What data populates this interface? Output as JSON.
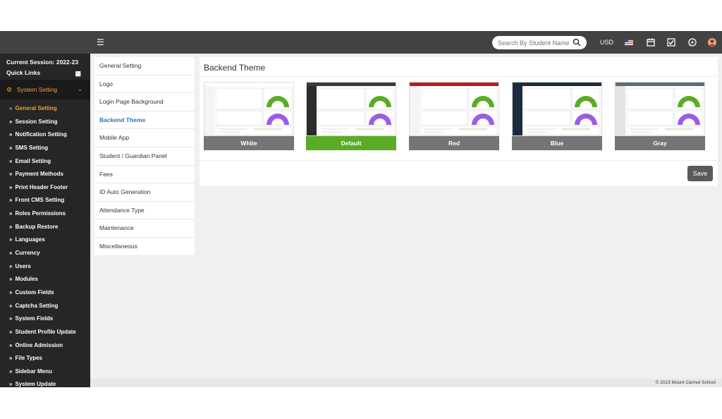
{
  "topbar": {
    "search_placeholder": "Search By Student Name",
    "currency": "USD"
  },
  "sidebar": {
    "session": "Current Session: 2022-23",
    "quick_links": "Quick Links",
    "section": "System Setting",
    "items": [
      {
        "label": "General Setting"
      },
      {
        "label": "Session Setting"
      },
      {
        "label": "Notification Setting"
      },
      {
        "label": "SMS Setting"
      },
      {
        "label": "Email Setting"
      },
      {
        "label": "Payment Methods"
      },
      {
        "label": "Print Header Footer"
      },
      {
        "label": "Front CMS Setting"
      },
      {
        "label": "Roles Permissions"
      },
      {
        "label": "Backup Restore"
      },
      {
        "label": "Languages"
      },
      {
        "label": "Currency"
      },
      {
        "label": "Users"
      },
      {
        "label": "Modules"
      },
      {
        "label": "Custom Fields"
      },
      {
        "label": "Captcha Setting"
      },
      {
        "label": "System Fields"
      },
      {
        "label": "Student Profile Update"
      },
      {
        "label": "Online Admission"
      },
      {
        "label": "File Types"
      },
      {
        "label": "Sidebar Menu"
      },
      {
        "label": "System Update"
      }
    ]
  },
  "settings_menu": [
    {
      "label": "General Setting"
    },
    {
      "label": "Logo"
    },
    {
      "label": "Login Page Background"
    },
    {
      "label": "Backend Theme"
    },
    {
      "label": "Mobile App"
    },
    {
      "label": "Student / Guardian Panel"
    },
    {
      "label": "Fees"
    },
    {
      "label": "ID Auto Generation"
    },
    {
      "label": "Attendance Type"
    },
    {
      "label": "Maintenance"
    },
    {
      "label": "Miscellaneous"
    }
  ],
  "panel": {
    "title": "Backend Theme",
    "save_label": "Save",
    "themes": [
      {
        "label": "White",
        "color": "#757575",
        "header": "#ffffff",
        "side": "#f4f4f4"
      },
      {
        "label": "Default",
        "color": "#5aab25",
        "header": "#3c3c3c",
        "side": "#2b2b2b"
      },
      {
        "label": "Red",
        "color": "#757575",
        "header": "#b71c1c",
        "side": "#f4f4f4"
      },
      {
        "label": "Blue",
        "color": "#757575",
        "header": "#1d2b3f",
        "side": "#1d2b3f"
      },
      {
        "label": "Gray",
        "color": "#757575",
        "header": "#5d6b7a",
        "side": "#e4e4e4"
      }
    ]
  },
  "footer": {
    "copyright": "© 2023 Mount Carmel School"
  },
  "colors": {
    "topbar": "#424242",
    "sidebar": "#262626",
    "accent": "#f0a030",
    "active_link": "#2a75b5"
  }
}
